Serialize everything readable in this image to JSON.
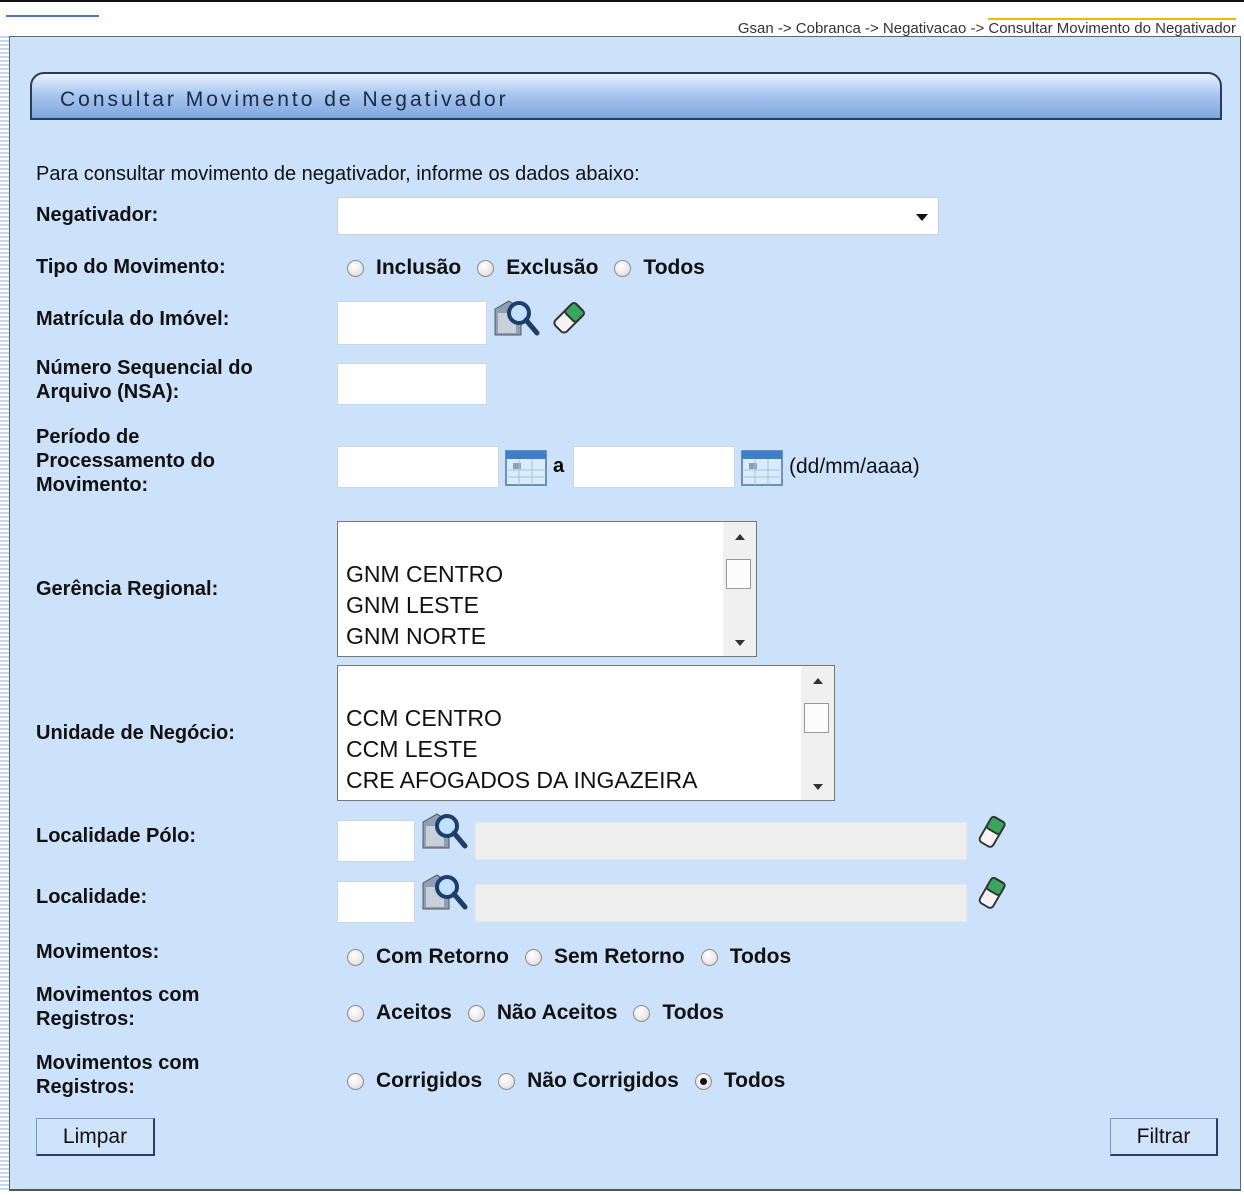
{
  "breadcrumb": {
    "path": "Gsan -> Cobranca -> Negativacao -> ",
    "current": "Consultar Movimento do Negativador"
  },
  "page_title": "Consultar Movimento de Negativador",
  "intro": "Para consultar movimento de negativador, informe os dados abaixo:",
  "labels": {
    "negativador": "Negativador:",
    "tipo_movimento": "Tipo do Movimento:",
    "matricula": "Matrícula do Imóvel:",
    "nsa_1": "Número Sequencial do",
    "nsa_2": "Arquivo (NSA):",
    "periodo_1": "Período de",
    "periodo_2": "Processamento do",
    "periodo_3": "Movimento:",
    "gerencia": "Gerência Regional:",
    "unidade": "Unidade de Negócio:",
    "localidade_polo": "Localidade Pólo:",
    "localidade": "Localidade:",
    "movimentos": "Movimentos:",
    "mov_reg_a_1": "Movimentos com",
    "mov_reg_a_2": "Registros:",
    "mov_reg_b_1": "Movimentos com",
    "mov_reg_b_2": "Registros:"
  },
  "radios": {
    "tipo_movimento": [
      "Inclusão",
      "Exclusão",
      "Todos"
    ],
    "movimentos": [
      "Com Retorno",
      "Sem Retorno",
      "Todos"
    ],
    "registros_aceitos": [
      "Aceitos",
      "Não Aceitos",
      "Todos"
    ],
    "registros_corrigidos": [
      "Corrigidos",
      "Não Corrigidos",
      "Todos"
    ],
    "registros_corrigidos_selected": "Todos"
  },
  "periodo": {
    "separator": "a",
    "format": "(dd/mm/aaaa)"
  },
  "gerencia_options": [
    "GNM CENTRO",
    "GNM LESTE",
    "GNM NORTE"
  ],
  "unidade_options": [
    "CCM CENTRO",
    "CCM LESTE",
    "CRE AFOGADOS DA INGAZEIRA"
  ],
  "buttons": {
    "limpar": "Limpar",
    "filtrar": "Filtrar"
  }
}
